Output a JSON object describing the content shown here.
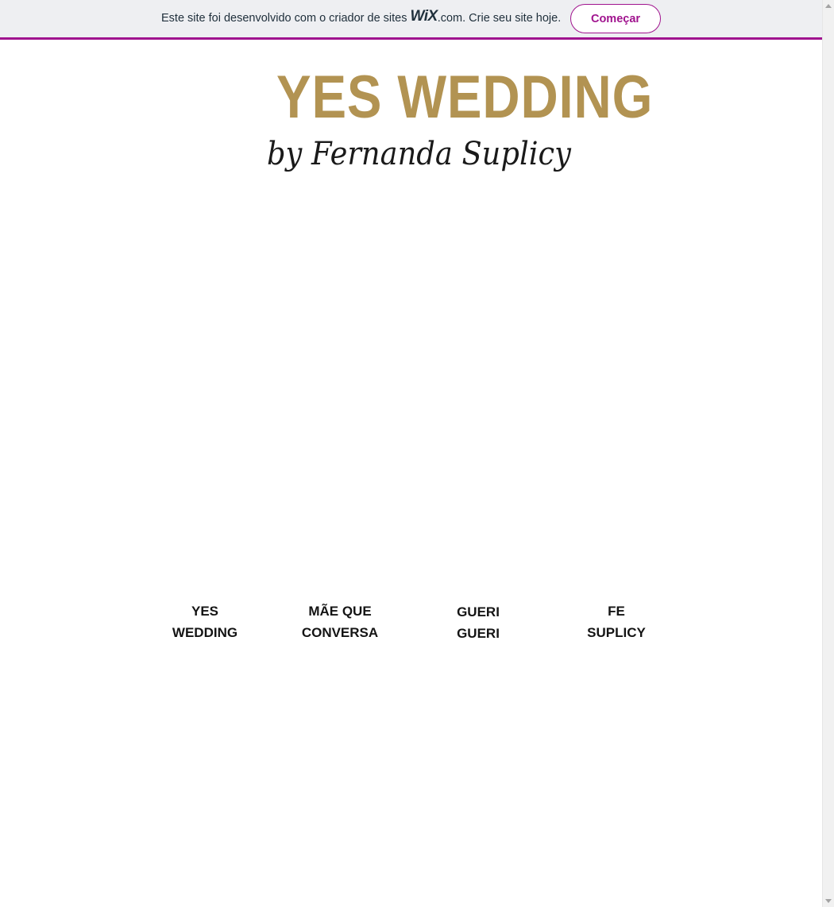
{
  "wix_banner": {
    "text_before": "Este site foi desenvolvido com o criador de sites",
    "logo": "WiX",
    "dotcom": ".com",
    "text_after": ". Crie seu site hoje.",
    "button_label": "Começar",
    "accent_color": "#a0138e"
  },
  "logo": {
    "title": "YES WEDDING",
    "subtitle": "by Fernanda Suplicy",
    "title_color": "#b29352"
  },
  "nav": {
    "items": [
      {
        "line1": "YES",
        "line2": "WEDDING"
      },
      {
        "line1": "MÃE QUE",
        "line2": "CONVERSA"
      },
      {
        "line1": "GUERI",
        "line2": "GUERI"
      },
      {
        "line1": "FE",
        "line2": "SUPLICY"
      }
    ]
  },
  "icons": {
    "scroll_up": "chevron-up-icon",
    "scroll_down": "chevron-down-icon"
  }
}
